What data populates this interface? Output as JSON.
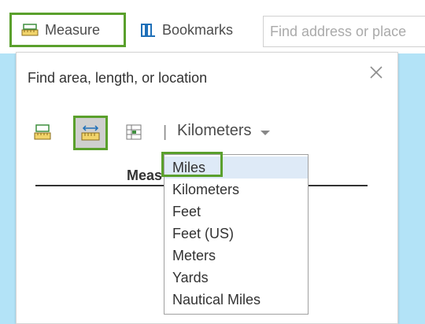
{
  "toolbar": {
    "measure_label": "Measure",
    "bookmarks_label": "Bookmarks",
    "search_placeholder": "Find address or place"
  },
  "panel": {
    "title": "Find area, length, or location",
    "unit_label": "Kilometers",
    "unit_separator": "|",
    "result_header": "Meas"
  },
  "dropdown": {
    "options": [
      "Miles",
      "Kilometers",
      "Feet",
      "Feet (US)",
      "Meters",
      "Yards",
      "Nautical Miles"
    ],
    "selected": "Miles"
  },
  "colors": {
    "highlight": "#5aa02c",
    "map": "#b3e3f7",
    "selected_bg": "#deeaf7"
  },
  "icons": {
    "measure": "ruler-area-icon",
    "bookmarks": "bookmarks-icon",
    "close": "close-icon",
    "area_tool": "area-measure-icon",
    "distance_tool": "distance-measure-icon",
    "location_tool": "location-measure-icon",
    "caret": "chevron-down-icon"
  }
}
